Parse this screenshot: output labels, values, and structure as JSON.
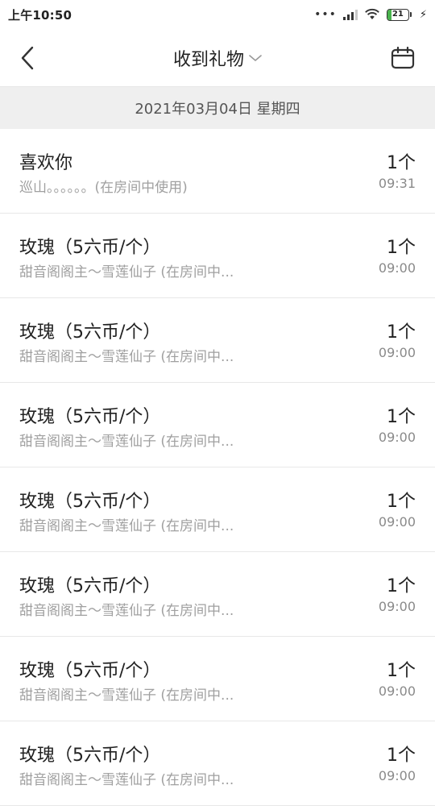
{
  "status_bar": {
    "time": "上午10:50",
    "dots": "•••",
    "battery": "21",
    "battery_level": 0.21,
    "battery_color": "#49b34d"
  },
  "nav": {
    "title": "收到礼物"
  },
  "date_header": "2021年03月04日 星期四",
  "gifts": [
    {
      "name": "喜欢你",
      "detail": "巡山。。。。。。(在房间中使用)",
      "qty": "1个",
      "time": "09:31"
    },
    {
      "name": "玫瑰（5六币/个）",
      "detail": "甜音阁阁主～雪莲仙子 (在房间中...",
      "qty": "1个",
      "time": "09:00"
    },
    {
      "name": "玫瑰（5六币/个）",
      "detail": "甜音阁阁主～雪莲仙子 (在房间中...",
      "qty": "1个",
      "time": "09:00"
    },
    {
      "name": "玫瑰（5六币/个）",
      "detail": "甜音阁阁主～雪莲仙子 (在房间中...",
      "qty": "1个",
      "time": "09:00"
    },
    {
      "name": "玫瑰（5六币/个）",
      "detail": "甜音阁阁主～雪莲仙子 (在房间中...",
      "qty": "1个",
      "time": "09:00"
    },
    {
      "name": "玫瑰（5六币/个）",
      "detail": "甜音阁阁主～雪莲仙子 (在房间中...",
      "qty": "1个",
      "time": "09:00"
    },
    {
      "name": "玫瑰（5六币/个）",
      "detail": "甜音阁阁主～雪莲仙子 (在房间中...",
      "qty": "1个",
      "time": "09:00"
    },
    {
      "name": "玫瑰（5六币/个）",
      "detail": "甜音阁阁主～雪莲仙子 (在房间中...",
      "qty": "1个",
      "time": "09:00"
    }
  ]
}
